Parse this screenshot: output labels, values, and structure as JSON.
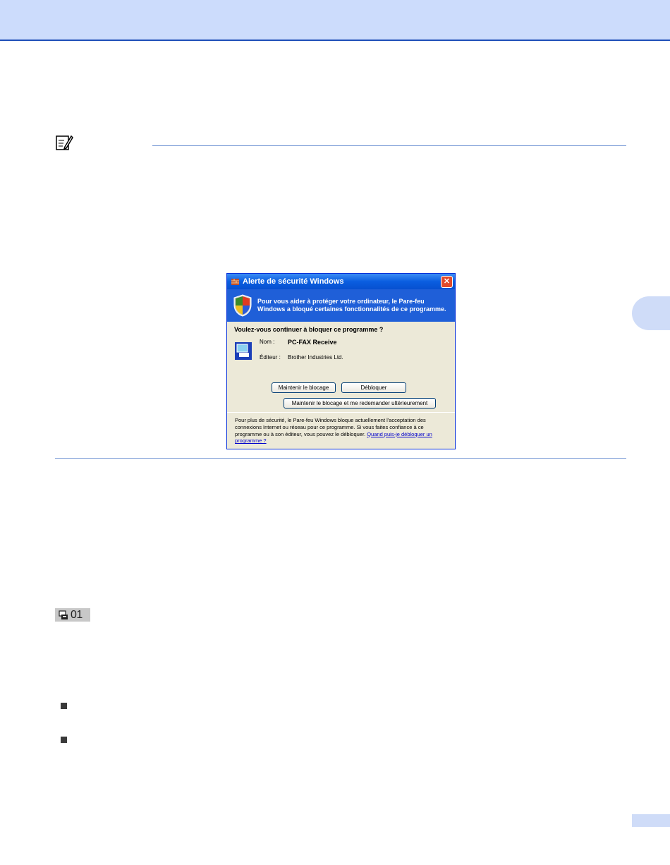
{
  "dialog": {
    "title": "Alerte de sécurité Windows",
    "close_glyph": "✕",
    "banner_text": "Pour vous aider à protéger votre ordinateur, le Pare-feu Windows a bloqué certaines fonctionnalités de ce programme.",
    "question": "Voulez-vous continuer à bloquer ce programme ?",
    "name_label": "Nom :",
    "name_value": "PC-FAX Receive",
    "publisher_label": "Éditeur :",
    "publisher_value": "Brother Industries Ltd.",
    "buttons": {
      "keep_blocking": "Maintenir le blocage",
      "unblock": "Débloquer",
      "ask_later": "Maintenir le blocage et me redemander ultérieurement"
    },
    "footer_text": "Pour plus de sécurité, le Pare-feu Windows bloque actuellement l'acceptation des connexions Internet ou réseau pour ce programme. Si vous faites confiance à ce programme ou à son éditeur, vous pouvez le débloquer. ",
    "footer_link": "Quand puis-je débloquer un programme ?"
  },
  "status_indicator": {
    "count": "01",
    "icon": "pc-fax-icon"
  },
  "icons": {
    "note": "note-pencil-icon",
    "shield": "security-shield-icon",
    "application": "pc-fax-app-icon"
  },
  "colors": {
    "header_band": "#ccdcfc",
    "header_line": "#1f4fb8",
    "rule": "#7f9fd8",
    "xp_titlebar": "#0a5ee0",
    "xp_banner": "#1f5fd8",
    "xp_dialog_bg": "#ece9d8"
  }
}
